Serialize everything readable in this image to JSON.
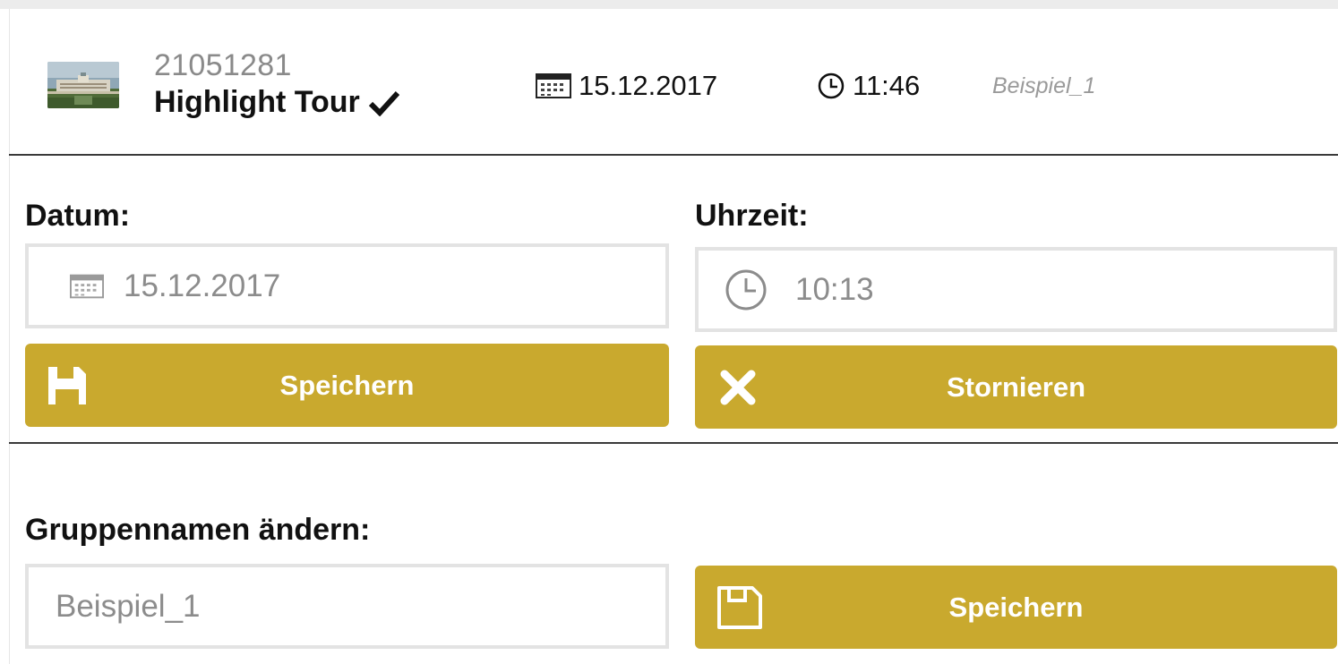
{
  "header": {
    "thumbnail_icon": "palace-photo-icon",
    "tour_number": "21051281",
    "tour_name": "Highlight Tour",
    "tour_status_icon": "checkmark-icon",
    "date": "15.12.2017",
    "date_icon": "calendar-icon",
    "time": "11:46",
    "time_icon": "clock-icon",
    "group_name": "Beispiel_1"
  },
  "edit_datetime": {
    "date_label": "Datum:",
    "date_value": "15.12.2017",
    "date_icon": "calendar-icon",
    "time_label": "Uhrzeit:",
    "time_value": "10:13",
    "time_icon": "clock-icon",
    "save_label": "Speichern",
    "save_icon": "floppy-disk-icon",
    "cancel_label": "Stornieren",
    "cancel_icon": "close-x-icon"
  },
  "group_rename": {
    "label": "Gruppennamen ändern:",
    "value": "Beispiel_1",
    "save_label": "Speichern",
    "save_icon": "floppy-disk-outline-icon"
  },
  "colors": {
    "accent": "#c9a92e",
    "divider": "#3a3a3a",
    "field_border": "#e3e3e3",
    "muted_text": "#8c8c8c"
  }
}
